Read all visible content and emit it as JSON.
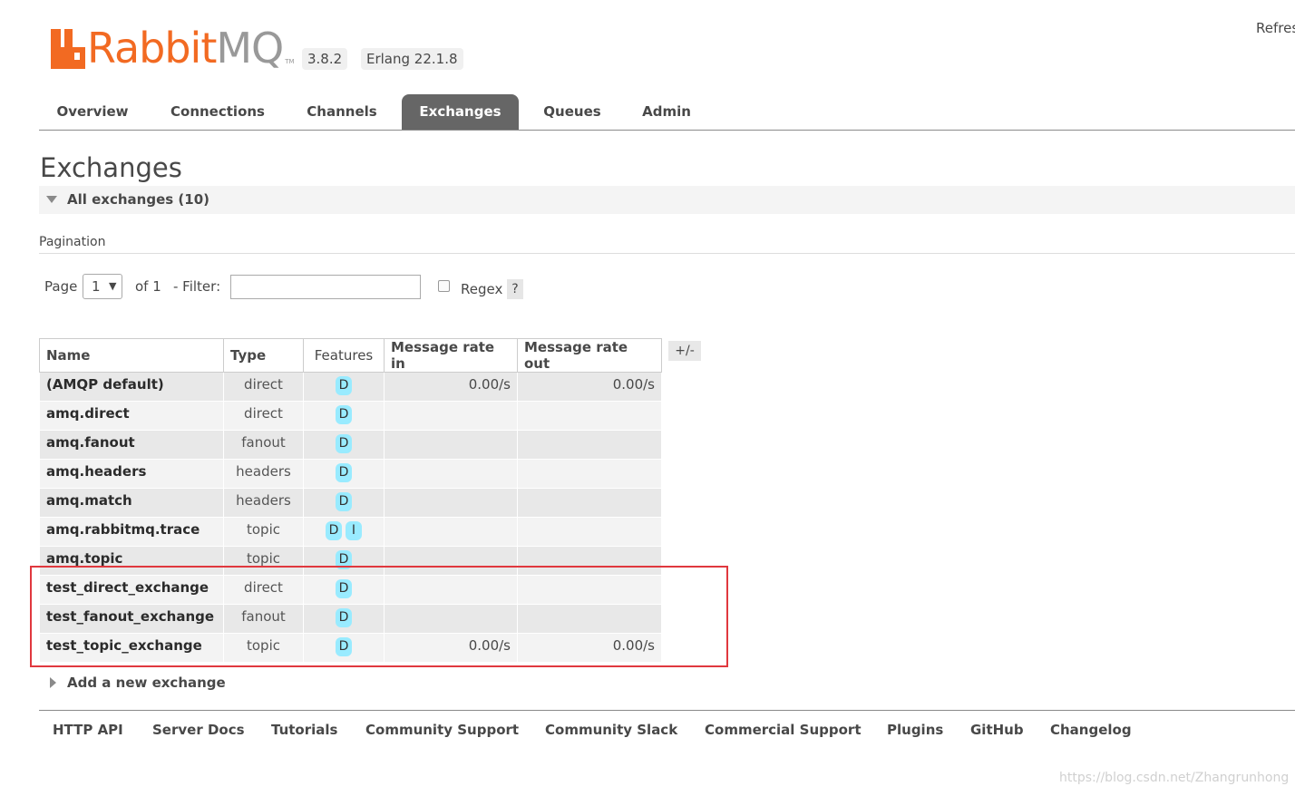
{
  "app": {
    "brand_rabbit": "Rabbit",
    "brand_mq": "MQ",
    "brand_tm": "TM",
    "version": "3.8.2",
    "erlang": "Erlang 22.1.8",
    "refresh": "Refres"
  },
  "tabs": [
    {
      "label": "Overview",
      "active": false
    },
    {
      "label": "Connections",
      "active": false
    },
    {
      "label": "Channels",
      "active": false
    },
    {
      "label": "Exchanges",
      "active": true
    },
    {
      "label": "Queues",
      "active": false
    },
    {
      "label": "Admin",
      "active": false
    }
  ],
  "page": {
    "title": "Exchanges",
    "section_title": "All exchanges (10)"
  },
  "pagination": {
    "label": "Pagination",
    "page_label": "Page",
    "page_value": "1",
    "of_label": "of 1",
    "filter_label": "- Filter:",
    "filter_value": "",
    "regex_label": "Regex",
    "regex_checked": false,
    "help": "?"
  },
  "table": {
    "headers": {
      "name": "Name",
      "type": "Type",
      "features": "Features",
      "rate_in": "Message rate in",
      "rate_out": "Message rate out"
    },
    "column_toggle": "+/-",
    "rows": [
      {
        "name": "(AMQP default)",
        "type": "direct",
        "features": [
          "D"
        ],
        "rate_in": "0.00/s",
        "rate_out": "0.00/s"
      },
      {
        "name": "amq.direct",
        "type": "direct",
        "features": [
          "D"
        ],
        "rate_in": "",
        "rate_out": ""
      },
      {
        "name": "amq.fanout",
        "type": "fanout",
        "features": [
          "D"
        ],
        "rate_in": "",
        "rate_out": ""
      },
      {
        "name": "amq.headers",
        "type": "headers",
        "features": [
          "D"
        ],
        "rate_in": "",
        "rate_out": ""
      },
      {
        "name": "amq.match",
        "type": "headers",
        "features": [
          "D"
        ],
        "rate_in": "",
        "rate_out": ""
      },
      {
        "name": "amq.rabbitmq.trace",
        "type": "topic",
        "features": [
          "D",
          "I"
        ],
        "rate_in": "",
        "rate_out": ""
      },
      {
        "name": "amq.topic",
        "type": "topic",
        "features": [
          "D"
        ],
        "rate_in": "",
        "rate_out": ""
      },
      {
        "name": "test_direct_exchange",
        "type": "direct",
        "features": [
          "D"
        ],
        "rate_in": "",
        "rate_out": ""
      },
      {
        "name": "test_fanout_exchange",
        "type": "fanout",
        "features": [
          "D"
        ],
        "rate_in": "",
        "rate_out": ""
      },
      {
        "name": "test_topic_exchange",
        "type": "topic",
        "features": [
          "D"
        ],
        "rate_in": "0.00/s",
        "rate_out": "0.00/s"
      }
    ]
  },
  "add_exchange": {
    "label": "Add a new exchange"
  },
  "footer": {
    "links": [
      "HTTP API",
      "Server Docs",
      "Tutorials",
      "Community Support",
      "Community Slack",
      "Commercial Support",
      "Plugins",
      "GitHub",
      "Changelog"
    ]
  },
  "watermark": "https://blog.csdn.net/Zhangrunhong",
  "colors": {
    "brand_orange": "#f26a22",
    "active_tab": "#666666",
    "feature_badge": "#99ebff",
    "highlight": "#e0383e"
  }
}
